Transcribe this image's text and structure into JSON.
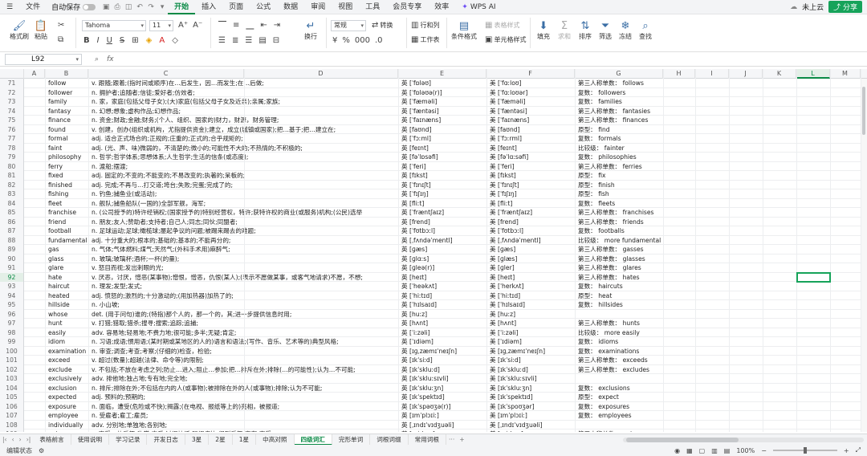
{
  "menu": {
    "file": "文件",
    "autosave": "自动保存",
    "tabs": [
      "开始",
      "插入",
      "页面",
      "公式",
      "数据",
      "审阅",
      "视图",
      "工具",
      "会员专享",
      "效率"
    ],
    "active_tab": "开始",
    "wps_ai": "WPS AI",
    "cloud": "未上云",
    "share": "分享"
  },
  "ribbon": {
    "format_painter": "格式刷",
    "paste": "粘贴",
    "font_name": "Tahoma",
    "font_size": "11",
    "number_format": "常规",
    "convert": "转换",
    "wrap": "换行",
    "row_col": "行和列",
    "worksheet": "工作表",
    "cond_format": "条件格式",
    "cell_style": "单元格样式",
    "table_style": "表格样式",
    "sum": "求和",
    "fill": "填充",
    "filter": "筛选",
    "sort": "排序",
    "freeze": "冻结",
    "find": "查找"
  },
  "formula_bar": {
    "cell_ref": "L92"
  },
  "columns": [
    "A",
    "B",
    "C",
    "D",
    "E",
    "F",
    "G",
    "H",
    "I",
    "J",
    "K",
    "L",
    "M"
  ],
  "selected_column": "L",
  "selected_row": "92",
  "rows": [
    {
      "n": "71",
      "word": "follow",
      "def": "v. 跟随;跟着;(指时间或顺序)在…后发生，因…而发生;在…后做;",
      "uk": "英 [ˈfɒləʊ]",
      "us": "美 [ˈfɑːloʊ]",
      "form": "第三人称单数： follows"
    },
    {
      "n": "72",
      "word": "follower",
      "def": "n. 拥护者;追随者;信徒;爱好者;仿效者;",
      "uk": "英 [ˈfɒləʊə(r)]",
      "us": "美 [ˈfɑːloʊər]",
      "form": "复数： followers"
    },
    {
      "n": "73",
      "word": "family",
      "def": "n. 家，家庭(包括父母子女);(大)家庭(包括父母子女及近亲);亲属;家族;",
      "uk": "英 [ˈfæməli]",
      "us": "美 [ˈfæməli]",
      "form": "复数： families"
    },
    {
      "n": "74",
      "word": "fantasy",
      "def": "n. 幻想;想象;虚构作品;幻想作品;",
      "uk": "英 [ˈfæntəsi]",
      "us": "美 [ˈfæntəsi]",
      "form": "第三人称单数： fantasies"
    },
    {
      "n": "75",
      "word": "finance",
      "def": "n. 资金;财政;金融;财务;(个人、组织、国家的)财力，财源，财务管理;",
      "uk": "英 [ˈfaɪnæns]",
      "us": "美 [ˈfaɪnæns]",
      "form": "第三人称单数： finances"
    },
    {
      "n": "76",
      "word": "found",
      "def": "v. 创建，创办(组织或机构，尤指提供资金);建立，成立(城镇或国家);把…基于;把…建立在;",
      "uk": "英 [faʊnd]",
      "us": "美 [faʊnd]",
      "form": "原型： find"
    },
    {
      "n": "77",
      "word": "formal",
      "def": "adj. 适合正式场合的;正规的;庄重的;正式的;合乎规矩的;",
      "uk": "英 [ˈfɔːml]",
      "us": "美 [ˈfɔːrml]",
      "form": "复数： formals"
    },
    {
      "n": "78",
      "word": "faint",
      "def": "adj. (光、声、味)微弱的，不清楚的;微小的;可能性不大的;不热情的;不积极的;",
      "uk": "英 [feɪnt]",
      "us": "美 [feɪnt]",
      "form": "比较级： fainter"
    },
    {
      "n": "79",
      "word": "philosophy",
      "def": "n. 哲学;哲学体系;思想体系;人生哲学;生活的信条(或态度);",
      "uk": "英 [fəˈlɒsəfi]",
      "us": "美 [fəˈlɑːsəfi]",
      "form": "复数： philosophies"
    },
    {
      "n": "80",
      "word": "ferry",
      "def": "n. 渡船;摆渡;",
      "uk": "英 [ˈferi]",
      "us": "美 [ˈferi]",
      "form": "第三人称单数： ferries"
    },
    {
      "n": "81",
      "word": "fixed",
      "def": "adj. 固定的;不变的;不能变的;不易改变的;执著的;呆板的;",
      "uk": "英 [fɪkst]",
      "us": "美 [fɪkst]",
      "form": "原型： fix"
    },
    {
      "n": "82",
      "word": "finished",
      "def": "adj. 完成;不再与…打交道;垮台;失败;完蛋;完成了的;",
      "uk": "英 [ˈfɪnɪʃt]",
      "us": "美 [ˈfɪnɪʃt]",
      "form": "原型： finish"
    },
    {
      "n": "83",
      "word": "fishing",
      "def": "n. 钓鱼;捕鱼业(或活动);",
      "uk": "英 [ˈfɪʃɪŋ]",
      "us": "美 [ˈfɪʃɪŋ]",
      "form": "原型： fish"
    },
    {
      "n": "84",
      "word": "fleet",
      "def": "n. 舰队;捕鱼船队(一国的)全部军舰，海军;",
      "uk": "英 [fliːt]",
      "us": "美 [fliːt]",
      "form": "复数： fleets"
    },
    {
      "n": "85",
      "word": "franchise",
      "def": "n. (公司授予的)特许经销权;(国家授予的)特别经营权，特许;获特许权的商业(或服务)机构;(公民)选举",
      "uk": "英 [ˈfræntʃaɪz]",
      "us": "美 [ˈfræntʃaɪz]",
      "form": "第三人称单数： franchises"
    },
    {
      "n": "86",
      "word": "friend",
      "def": "n. 朋友;友人;赞助者;支持者;自己人;同志;同伙;同盟者;",
      "uk": "英 [frend]",
      "us": "美 [frend]",
      "form": "第三人称单数： friends"
    },
    {
      "n": "87",
      "word": "football",
      "def": "n. 足球运动;足球;橄榄球;屡起争议的问题;被踢来踢去的难题;",
      "uk": "英 [ˈfʊtbɔːl]",
      "us": "美 [ˈfʊtbɔːl]",
      "form": "复数： footballs"
    },
    {
      "n": "88",
      "word": "fundamental",
      "def": "adj. 十分重大的;根本的;基础的;基本的;不能再分的;",
      "uk": "英 [ˌfʌndəˈmentl]",
      "us": "美 [ˌfʌndəˈmentl]",
      "form": "比较级： more fundamental"
    },
    {
      "n": "89",
      "word": "gas",
      "def": "n. 气体;气体燃料;煤气;天然气;(外科手术用)麻醉气;",
      "uk": "英 [ɡæs]",
      "us": "美 [ɡæs]",
      "form": "第三人称单数： gasses"
    },
    {
      "n": "90",
      "word": "glass",
      "def": "n. 玻璃;玻璃杯;酒杯;一杯(的量);",
      "uk": "英 [ɡlɑːs]",
      "us": "美 [ɡlæs]",
      "form": "第三人称单数： glasses"
    },
    {
      "n": "91",
      "word": "glare",
      "def": "v. 怒目而视;发出刺眼的光;",
      "uk": "英 [ɡleə(r)]",
      "us": "美 [ɡler]",
      "form": "第三人称单数： glares"
    },
    {
      "n": "92",
      "word": "hate",
      "def": "v. 厌恶，讨厌，憎恶(某事物);憎恨，憎恶，仇恨(某人);(表示不愿做某事，或客气地请求)不愿，不想;",
      "uk": "英 [heɪt]",
      "us": "美 [heɪt]",
      "form": "第三人称单数： hates"
    },
    {
      "n": "93",
      "word": "haircut",
      "def": "n. 理发;发型;发式;",
      "uk": "英 [ˈheəkʌt]",
      "us": "美 [ˈherkʌt]",
      "form": "复数： haircuts"
    },
    {
      "n": "94",
      "word": "heated",
      "def": "adj. 愤怒的;激烈的;十分激动的;(用加热器)加热了的;",
      "uk": "英 [ˈhiːtɪd]",
      "us": "美 [ˈhiːtɪd]",
      "form": "原型： heat"
    },
    {
      "n": "95",
      "word": "hillside",
      "def": "n. 小山坡;",
      "uk": "英 [ˈhɪlsaɪd]",
      "us": "美 [ˈhɪlsaɪd]",
      "form": "复数： hillsides"
    },
    {
      "n": "96",
      "word": "whose",
      "def": "det. (用于问句)谁的;(特指)那个人的，那一个的，其;进一步提供信息时用;",
      "uk": "英 [huːz]",
      "us": "美 [huːz]",
      "form": ""
    },
    {
      "n": "97",
      "word": "hunt",
      "def": "v. 打猎;猎取;猎杀;搜寻;搜索;追踪;追捕;",
      "uk": "英 [hʌnt]",
      "us": "美 [hʌnt]",
      "form": "第三人称单数： hunts"
    },
    {
      "n": "98",
      "word": "easily",
      "def": "adv. 容易地;轻易地;不费力地;很可能;多半;无疑;肯定;",
      "uk": "英 [ˈiːzəli]",
      "us": "美 [ˈiːzəli]",
      "form": "比较级： more easily"
    },
    {
      "n": "99",
      "word": "idiom",
      "def": "n. 习语;成语;惯用语;(某时期或某地区的人的)语言和语法;(写作、音乐、艺术等的)典型风格;",
      "uk": "英 [ˈɪdiəm]",
      "us": "美 [ˈɪdiəm]",
      "form": "复数： idioms"
    },
    {
      "n": "100",
      "word": "examination",
      "def": "n. 审查;调查;考查;考察;(仔细的)检查，检验;",
      "uk": "英 [ɪɡˌzæmɪˈneɪʃn]",
      "us": "美 [ɪɡˌzæmɪˈneɪʃn]",
      "form": "复数： examinations"
    },
    {
      "n": "101",
      "word": "exceed",
      "def": "v. 超过(数量);超越(法律、命令等)的限制;",
      "uk": "英 [ɪkˈsiːd]",
      "us": "美 [ɪkˈsiːd]",
      "form": "第三人称单数： exceeds"
    },
    {
      "n": "102",
      "word": "exclude",
      "def": "v. 不包括;不放在考虑之列;防止…进入;阻止…参加;把…排斥在外;排除(…的可能性);认为…不可能;",
      "uk": "英 [ɪkˈskluːd]",
      "us": "美 [ɪkˈskluːd]",
      "form": "第三人称单数： excludes"
    },
    {
      "n": "103",
      "word": "exclusively",
      "def": "adv. 排他地;独占地;专有地;完全地;",
      "uk": "英 [ɪkˈskluːsɪvli]",
      "us": "美 [ɪkˈskluːsɪvli]",
      "form": ""
    },
    {
      "n": "104",
      "word": "exclusion",
      "def": "n. 排斥;排除在外;不包括在内的人(或事物);被排除在外的人(或事物);排除;认为不可能;",
      "uk": "英 [ɪkˈskluːʒn]",
      "us": "美 [ɪkˈskluːʒn]",
      "form": "复数： exclusions"
    },
    {
      "n": "105",
      "word": "expected",
      "def": "adj. 预料的;预期的;",
      "uk": "英 [ɪkˈspektɪd]",
      "us": "美 [ɪkˈspektɪd]",
      "form": "原型： expect"
    },
    {
      "n": "106",
      "word": "exposure",
      "def": "n. 面临，遭受(危险或不快);揭露;(在电视、报纸等上的)亮相，被报道;",
      "uk": "英 [ɪkˈspəʊʒə(r)]",
      "us": "美 [ɪkˈspoʊʒər]",
      "form": "复数： exposures"
    },
    {
      "n": "107",
      "word": "employee",
      "def": "n. 受雇者;雇工;雇员;",
      "uk": "英 [ɪmˈplɔɪiː]",
      "us": "美 [ɪmˈplɔɪiː]",
      "form": "复数： employees"
    },
    {
      "n": "108",
      "word": "individually",
      "def": "adv. 分别地;单独地;各别地;",
      "uk": "英 [ˌɪndɪˈvɪdʒuəli]",
      "us": "美 [ˌɪndɪˈvɪdʒuəli]",
      "form": ""
    },
    {
      "n": "109",
      "word": "enjoy",
      "def": "v. 享受…的乐趣;欣赏;喜爱;过得快活;玩得痛快;得到乐趣;享有;享受;",
      "uk": "英 [ɪnˈdʒɔɪ]",
      "us": "美 [ɪnˈdʒɔɪ]",
      "form": "第三人称单数： enjoys"
    }
  ],
  "sheet_tabs": [
    "表格前言",
    "使用说明",
    "学习记录",
    "开发日志",
    "3星",
    "2星",
    "1星",
    "中高对照",
    "四级词汇",
    "完形单词",
    "词根词缀",
    "常用词根"
  ],
  "active_sheet": "四级词汇",
  "status": {
    "mode": "编辑状态",
    "zoom": "100%"
  }
}
